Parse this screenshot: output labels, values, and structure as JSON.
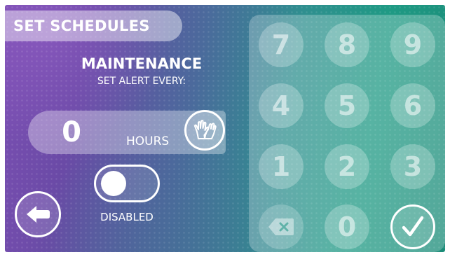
{
  "header": {
    "title": "SET SCHEDULES"
  },
  "settings": {
    "heading": "MAINTENANCE",
    "subheading": "SET ALERT EVERY:",
    "hours_value": "0",
    "hours_unit": "HOURS",
    "toggle_label": "DISABLED",
    "toggle_enabled": false
  },
  "keypad": {
    "keys": [
      "7",
      "8",
      "9",
      "4",
      "5",
      "6",
      "1",
      "2",
      "3",
      "0"
    ]
  },
  "icons": {
    "clear": "gloves-icon",
    "back": "arrow-left-icon",
    "backspace": "backspace-icon",
    "confirm": "checkmark-icon"
  }
}
